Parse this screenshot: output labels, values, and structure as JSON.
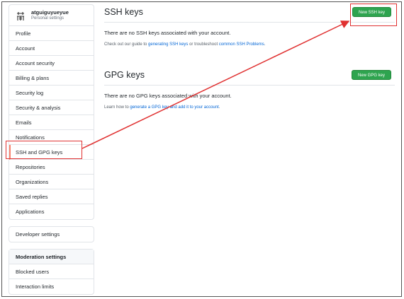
{
  "profile": {
    "username": "atguiguyueyue",
    "subtitle": "Personal settings"
  },
  "sidebar": {
    "items": [
      {
        "label": "Profile"
      },
      {
        "label": "Account"
      },
      {
        "label": "Account security"
      },
      {
        "label": "Billing & plans"
      },
      {
        "label": "Security log"
      },
      {
        "label": "Security & analysis"
      },
      {
        "label": "Emails"
      },
      {
        "label": "Notifications"
      },
      {
        "label": "SSH and GPG keys"
      },
      {
        "label": "Repositories"
      },
      {
        "label": "Organizations"
      },
      {
        "label": "Saved replies"
      },
      {
        "label": "Applications"
      }
    ],
    "developer": {
      "label": "Developer settings"
    },
    "moderation": {
      "header": "Moderation settings",
      "items": [
        {
          "label": "Blocked users"
        },
        {
          "label": "Interaction limits"
        }
      ]
    }
  },
  "ssh": {
    "title": "SSH keys",
    "button": "New SSH key",
    "empty": "There are no SSH keys associated with your account.",
    "help_pre": "Check out our guide to ",
    "help_link1": "generating SSH keys",
    "help_mid": " or troubleshoot ",
    "help_link2": "common SSH Problems",
    "help_post": "."
  },
  "gpg": {
    "title": "GPG keys",
    "button": "New GPG key",
    "empty": "There are no GPG keys associated with your account.",
    "help_pre": "Learn how to ",
    "help_link1": "generate a GPG key and add it to your account",
    "help_post": "."
  },
  "colors": {
    "accent_green": "#2ea44f",
    "link_blue": "#0366d6",
    "annotation_red": "#e03131",
    "selected_marker": "#f9826c"
  }
}
